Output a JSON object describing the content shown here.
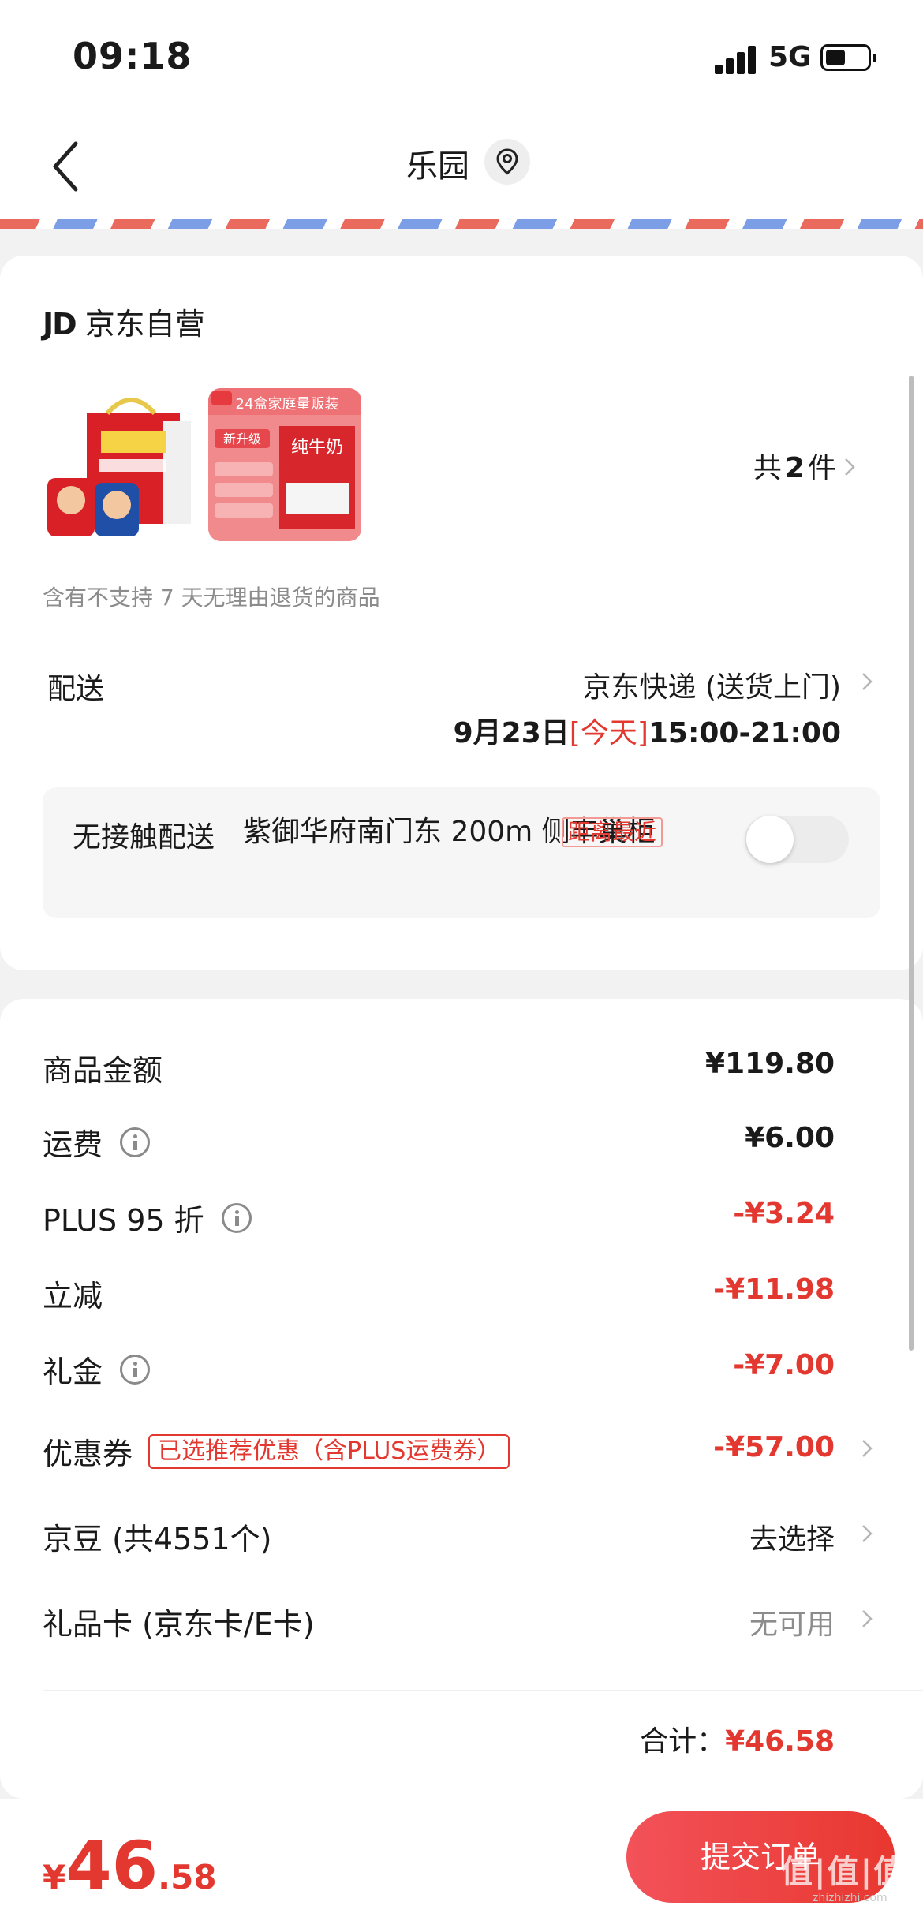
{
  "status_bar": {
    "time": "09:18",
    "network": "5G"
  },
  "nav": {
    "title": "乐园"
  },
  "shop": {
    "logo": "JD",
    "name": "京东自营"
  },
  "products": {
    "count_prefix": "共",
    "count": "2",
    "count_suffix": "件",
    "product2_banner": "24盒家庭量贩装",
    "product2_upgrade": "新升级",
    "product2_name": "纯牛奶"
  },
  "notice": "含有不支持 7 天无理由退货的商品",
  "delivery": {
    "label": "配送",
    "method": "京东快递 (送货上门)",
    "date": "9月23日",
    "day_tag": "[今天]",
    "time_range": "15:00-21:00"
  },
  "contactless": {
    "label": "无接触配送",
    "address": "紫御华府南门东 200m 侧丰巢柜",
    "tag": "距离最近",
    "enabled": false
  },
  "summary": {
    "rows": [
      {
        "label": "商品金额",
        "value": "¥119.80"
      },
      {
        "label": "运费",
        "value": "¥6.00"
      },
      {
        "label": "PLUS 95 折",
        "value": "-¥3.24"
      },
      {
        "label": "立减",
        "value": "-¥11.98"
      },
      {
        "label": "礼金",
        "value": "-¥7.00"
      },
      {
        "label": "优惠券",
        "tag": "已选推荐优惠（含PLUS运费券）",
        "value": "-¥57.00"
      },
      {
        "label": "京豆 (共4551个)",
        "value": "去选择"
      },
      {
        "label": "礼品卡 (京东卡/E卡)",
        "value": "无可用"
      }
    ],
    "total_label": "合计：",
    "total_value": "¥46.58"
  },
  "bottom": {
    "currency": "¥",
    "price_int": "46",
    "price_dec": ".58",
    "submit_label": "提交订单",
    "watermark": "值|值|值",
    "watermark_url": "zhizhizhi.com"
  },
  "colors": {
    "accent": "#e3382f",
    "background": "#f2f2f2"
  }
}
